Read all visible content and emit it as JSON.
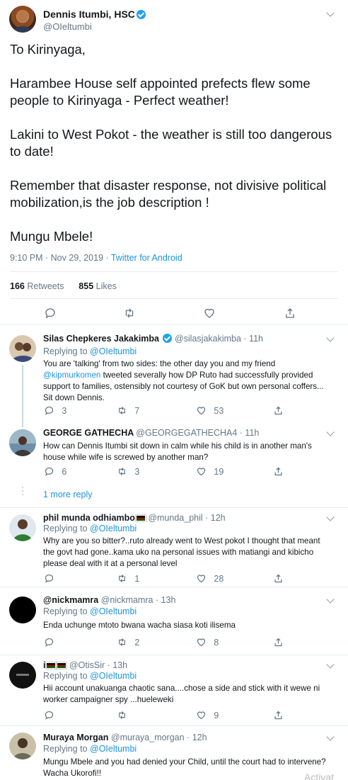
{
  "main_tweet": {
    "author": "Dennis Itumbi, HSC",
    "handle": "@OIeltumbi",
    "paragraphs": [
      "To Kirinyaga,",
      "Harambee House self appointed prefects flew some people to Kirinyaga - Perfect weather!",
      "Lakini to West Pokot - the weather is still too dangerous to date!",
      "Remember that disaster response, not divisive political mobilization,is the job description !",
      "Mungu Mbele!"
    ],
    "time": "9:10 PM · Nov 29, 2019 · ",
    "source": "Twitter for Android",
    "retweets_count": "166",
    "retweets_label": "Retweets",
    "likes_count": "855",
    "likes_label": "Likes"
  },
  "replies": [
    {
      "name": "Silas Chepkeres Jakakimba",
      "handle": "@silasjakakimba · 11h",
      "replying_prefix": "Replying to ",
      "replying_to": "@OIeltumbi",
      "text_before": "You are 'talking' from two sides: the other day you and my friend ",
      "mention": "@kipmurkomen",
      "text_after": " tweeted severally how DP Ruto had successfully provided support to families, ostensibly not courtesy of GoK but own personal coffers... Sit down Dennis.",
      "replies": "3",
      "retweets": "7",
      "likes": "53"
    },
    {
      "name": "GEORGE GATHECHA",
      "handle": "@GEORGEGATHECHA4 · 11h",
      "text": "How can Dennis Itumbi sit down in calm while his child is in another man's house while wife is screwed by another man?",
      "replies": "6",
      "retweets": "3",
      "likes": "19",
      "more_replies": "1 more reply"
    },
    {
      "name": "phil munda odhiambo",
      "handle": "@munda_phil · 12h",
      "replying_prefix": "Replying to ",
      "replying_to": "@OIeltumbi",
      "text": "Why are you so bitter?..ruto already went to West pokot I thought that meant the govt had gone..kama uko na personal issues with matiangi and kibicho please deal with it at a personal level",
      "replies": "",
      "retweets": "1",
      "likes": "28"
    },
    {
      "name": "@nickmamra",
      "handle": "@nickmamra · 13h",
      "replying_prefix": "Replying to ",
      "replying_to": "@OIeltumbi",
      "text": "Enda uchunge mtoto bwana wacha siasa koti ilisema",
      "replies": "",
      "retweets": "2",
      "likes": "8"
    },
    {
      "name": "i",
      "handle": "@OtisSir · 13h",
      "replying_prefix": "Replying to ",
      "replying_to": "@OIeltumbi",
      "text": "Hii account unakuanga chaotic sana....chose a side and stick with it wewe ni worker campaigner spy ...hueleweki",
      "replies": "",
      "retweets": "",
      "likes": "9"
    },
    {
      "name": "Muraya Morgan",
      "handle": "@muraya_morgan · 12h",
      "replying_prefix": "Replying to ",
      "replying_to": "@OIeltumbi",
      "text": "Mungu Mbele and you had denied your Child, until the court had to intervene? Wacha Ukorofi!!"
    }
  ],
  "watermark": "Activat",
  "colors": {
    "link": "#1b95e0",
    "verified": "#1da1f2",
    "muted": "#657786",
    "border": "#e6ecf0"
  }
}
